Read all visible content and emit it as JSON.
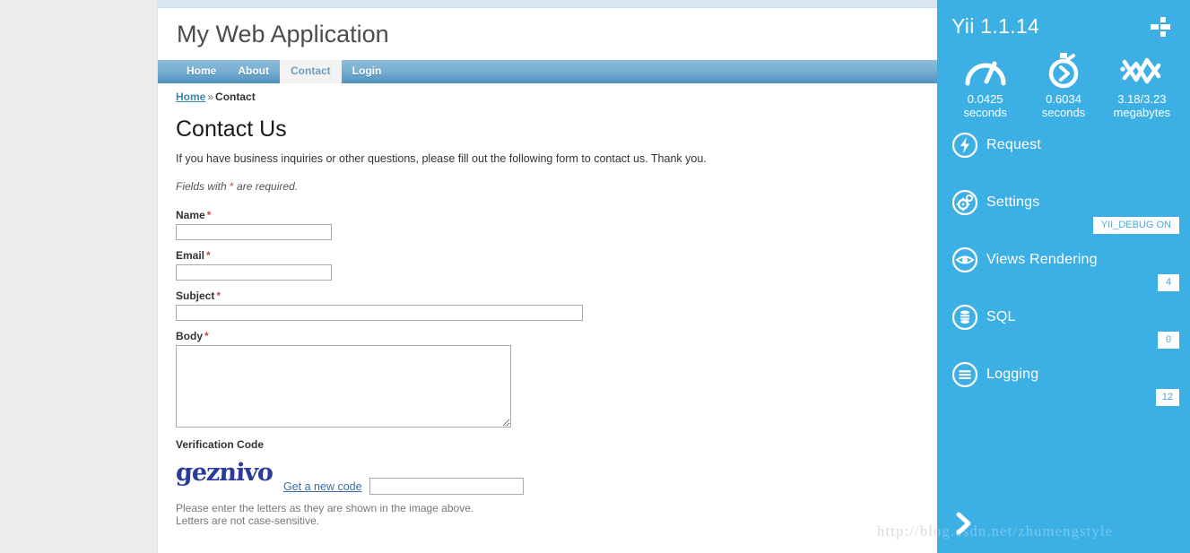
{
  "site": {
    "title": "My Web Application"
  },
  "nav": {
    "items": [
      {
        "label": "Home",
        "active": false
      },
      {
        "label": "About",
        "active": false
      },
      {
        "label": "Contact",
        "active": true
      },
      {
        "label": "Login",
        "active": false
      }
    ]
  },
  "breadcrumb": {
    "home": "Home",
    "separator": "»",
    "current": "Contact"
  },
  "page": {
    "title": "Contact Us",
    "intro": "If you have business inquiries or other questions, please fill out the following form to contact us. Thank you.",
    "required_note_prefix": "Fields with ",
    "required_marker": "*",
    "required_note_suffix": " are required."
  },
  "form": {
    "name": {
      "label": "Name",
      "required": "*",
      "value": "",
      "placeholder": ""
    },
    "email": {
      "label": "Email",
      "required": "*",
      "value": "",
      "placeholder": ""
    },
    "subject": {
      "label": "Subject",
      "required": "*",
      "value": "",
      "placeholder": ""
    },
    "body": {
      "label": "Body",
      "required": "*",
      "value": "",
      "placeholder": ""
    },
    "captcha": {
      "label": "Verification Code",
      "image_text": "geznivo",
      "refresh_link": "Get a new code",
      "value": "",
      "placeholder": "",
      "hint_line1": "Please enter the letters as they are shown in the image above.",
      "hint_line2": "Letters are not case-sensitive."
    }
  },
  "debug_panel": {
    "version": "Yii 1.1.14",
    "toggle_icon": "plus-icon",
    "accent_color": "#3cafe5",
    "badge_text_color": "#4aa8d8",
    "stats": [
      {
        "icon": "gauge-icon",
        "value": "0.0425",
        "unit": "seconds"
      },
      {
        "icon": "stopwatch-icon",
        "value": "0.6034",
        "unit": "seconds"
      },
      {
        "icon": "chart-line-icon",
        "value": "3.18/3.23",
        "unit": "megabytes"
      }
    ],
    "menu": [
      {
        "icon": "bolt-icon",
        "label": "Request",
        "badge": ""
      },
      {
        "icon": "gear-icon",
        "label": "Settings",
        "badge": "YII_DEBUG ON"
      },
      {
        "icon": "eye-icon",
        "label": "Views Rendering",
        "badge": "4"
      },
      {
        "icon": "database-icon",
        "label": "SQL",
        "badge": "0"
      },
      {
        "icon": "list-icon",
        "label": "Logging",
        "badge": "12"
      }
    ],
    "expand_icon": "chevron-right-icon"
  },
  "watermark": {
    "text": "http://blog.csdn.net/zhumengstyle"
  }
}
